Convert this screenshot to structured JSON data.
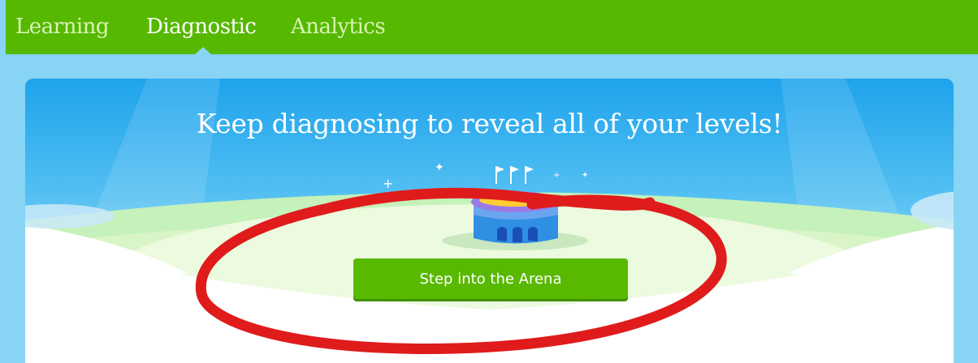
{
  "nav": {
    "tabs": [
      {
        "label": "Learning",
        "active": false
      },
      {
        "label": "Diagnostic",
        "active": true
      },
      {
        "label": "Analytics",
        "active": false
      }
    ]
  },
  "hero": {
    "headline": "Keep diagnosing to reveal all of your levels!",
    "cta_label": "Step into the Arena",
    "illustration": "arena-stadium-icon"
  },
  "colors": {
    "nav_bg": "#56b800",
    "page_bg": "#87d4f5",
    "button_bg": "#58b900",
    "annotation_stroke": "#e01b1b"
  },
  "annotation": {
    "shape": "hand-drawn-ellipse",
    "target": "cta-button"
  }
}
